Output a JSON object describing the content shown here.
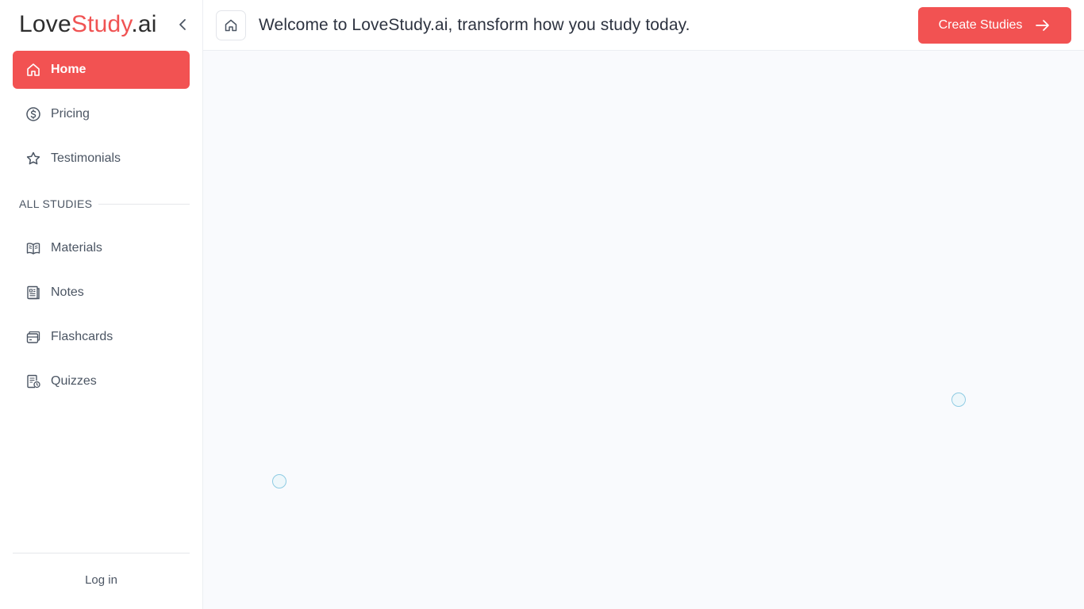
{
  "brand": {
    "logo_part1": "Love",
    "logo_part2": "Study",
    "logo_part3": ".ai"
  },
  "sidebar": {
    "top_items": [
      {
        "label": "Home",
        "icon": "home-icon",
        "active": true
      },
      {
        "label": "Pricing",
        "icon": "dollar-icon"
      },
      {
        "label": "Testimonials",
        "icon": "star-icon"
      }
    ],
    "section_label": "ALL STUDIES",
    "study_items": [
      {
        "label": "Materials",
        "icon": "book-icon"
      },
      {
        "label": "Notes",
        "icon": "notes-icon"
      },
      {
        "label": "Flashcards",
        "icon": "flashcards-icon"
      },
      {
        "label": "Quizzes",
        "icon": "quiz-icon"
      }
    ],
    "login_label": "Log in"
  },
  "header": {
    "welcome": "Welcome to LoveStudy.ai, transform how you study today.",
    "create_label": "Create Studies"
  },
  "colors": {
    "accent": "#f25252",
    "background": "#f9fafd"
  }
}
